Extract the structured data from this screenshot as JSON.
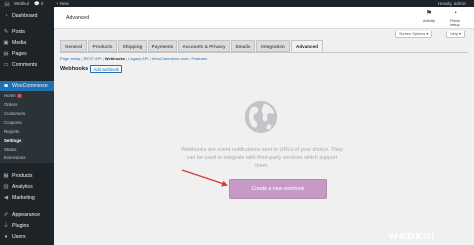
{
  "admin_bar": {
    "site_name": "Webkul",
    "comment_count": "0",
    "new_label": "+ New",
    "howdy": "Howdy, admin"
  },
  "sidebar": {
    "items": [
      {
        "label": "Dashboard",
        "icon": "dashboard-icon"
      },
      {
        "label": "Posts",
        "icon": "pin-icon"
      },
      {
        "label": "Media",
        "icon": "media-icon"
      },
      {
        "label": "Pages",
        "icon": "page-icon"
      },
      {
        "label": "Comments",
        "icon": "comment-icon"
      },
      {
        "label": "WooCommerce",
        "icon": "woo-icon"
      },
      {
        "label": "Products",
        "icon": "box-icon"
      },
      {
        "label": "Analytics",
        "icon": "chart-icon"
      },
      {
        "label": "Marketing",
        "icon": "megaphone-icon"
      },
      {
        "label": "Appearance",
        "icon": "brush-icon"
      },
      {
        "label": "Plugins",
        "icon": "plug-icon"
      },
      {
        "label": "Users",
        "icon": "user-icon"
      }
    ],
    "submenu": [
      {
        "label": "Home",
        "badge": "7"
      },
      {
        "label": "Orders"
      },
      {
        "label": "Customers"
      },
      {
        "label": "Coupons"
      },
      {
        "label": "Reports"
      },
      {
        "label": "Settings"
      },
      {
        "label": "Status"
      },
      {
        "label": "Extensions"
      }
    ]
  },
  "header": {
    "title": "Advanced",
    "activity_label": "Activity",
    "finish_setup_label": "Finish setup"
  },
  "screen_options_label": "Screen Options ▾",
  "help_label": "Help ▾",
  "tabs": [
    "General",
    "Products",
    "Shipping",
    "Payments",
    "Accounts & Privacy",
    "Emails",
    "Integration",
    "Advanced"
  ],
  "active_tab": "Advanced",
  "subsections": [
    "Page setup",
    "REST API",
    "Webhooks",
    "Legacy API",
    "WooCommerce.com",
    "Features"
  ],
  "current_subsection": "Webhooks",
  "page_heading": "Webhooks",
  "add_webhook_label": "Add webhook",
  "blank_state": {
    "message": "Webhooks are event notifications sent to URLs of your choice. They can be used to integrate with third-party services which support them.",
    "cta_label": "Create a new webhook"
  },
  "watermark": "webkul",
  "colors": {
    "admin_dark": "#1d2327",
    "wp_blue": "#2271b1",
    "woo_purple_light": "#c69ac5",
    "arrow_red": "#d63638"
  }
}
